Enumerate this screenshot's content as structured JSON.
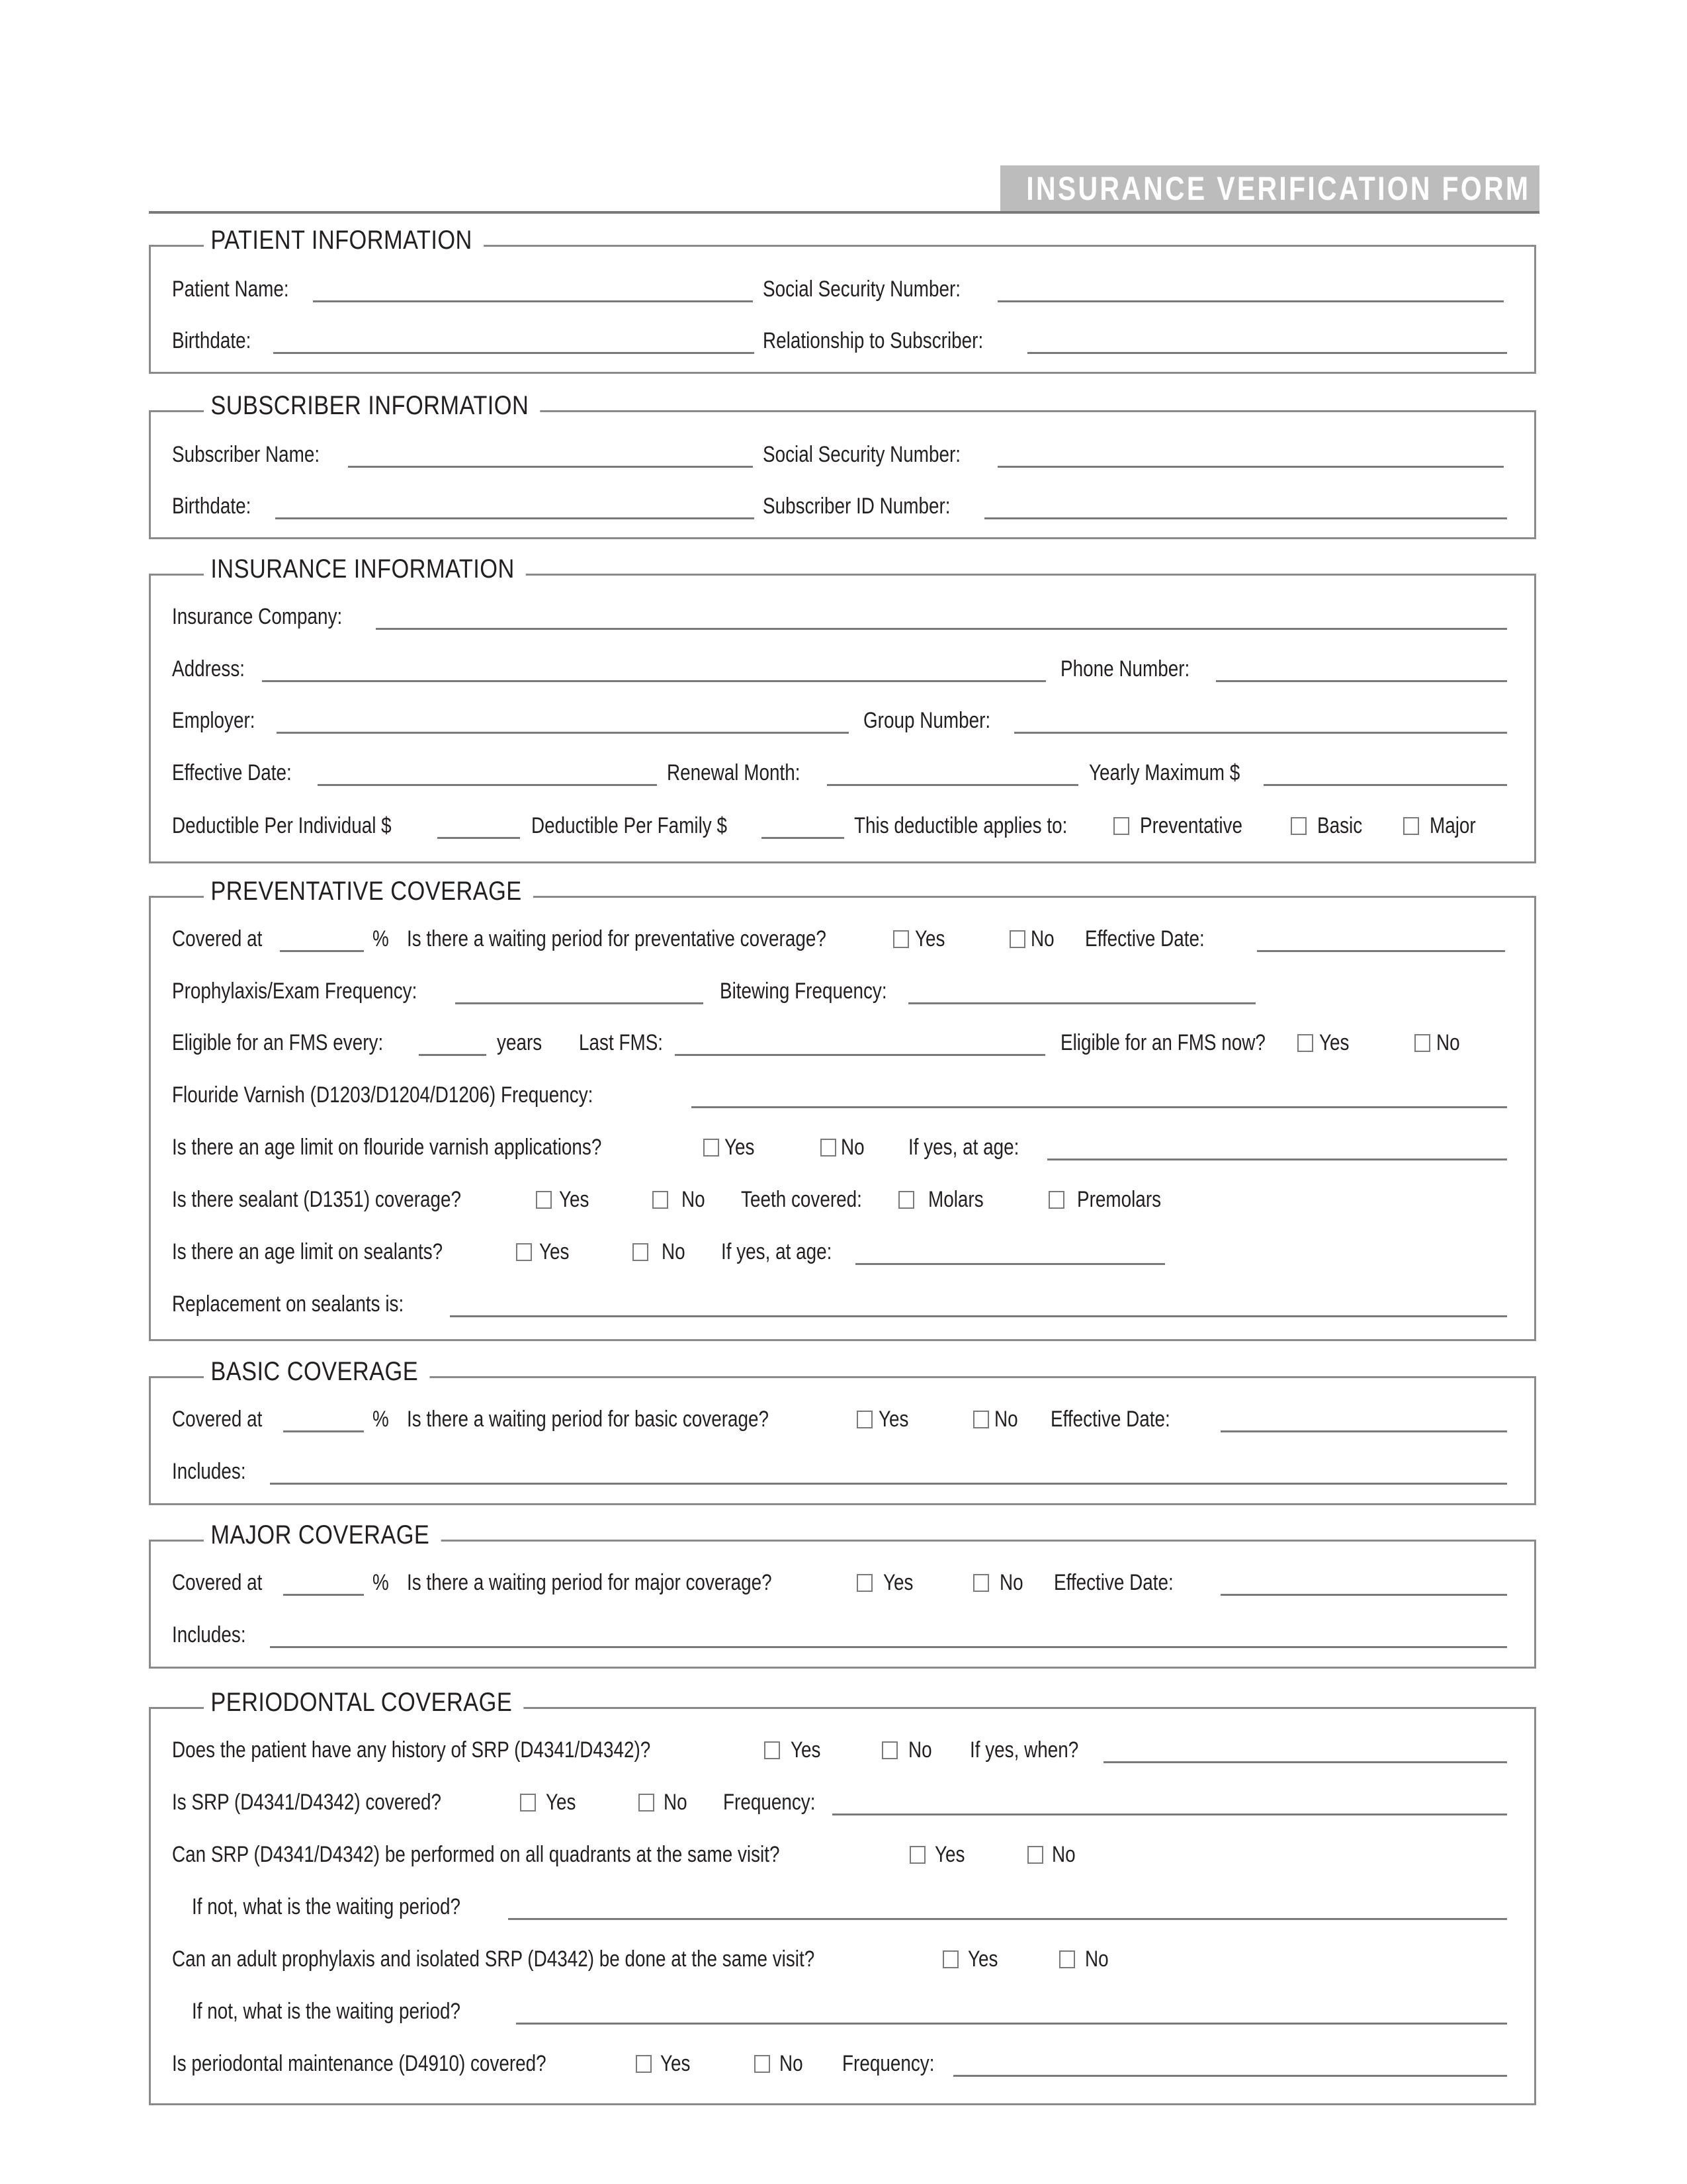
{
  "header": {
    "title": "INSURANCE VERIFICATION FORM"
  },
  "patient": {
    "heading": "PATIENT INFORMATION",
    "name_label": "Patient Name:",
    "ssn_label": "Social Security Number:",
    "birthdate_label": "Birthdate:",
    "relationship_label": "Relationship to Subscriber:"
  },
  "subscriber": {
    "heading": "SUBSCRIBER INFORMATION",
    "name_label": "Subscriber Name:",
    "ssn_label": "Social Security Number:",
    "birthdate_label": "Birthdate:",
    "id_label": "Subscriber ID Number:"
  },
  "insurance": {
    "heading": "INSURANCE INFORMATION",
    "company_label": "Insurance Company:",
    "address_label": "Address:",
    "phone_label": "Phone Number:",
    "employer_label": "Employer:",
    "group_label": "Group Number:",
    "effective_label": "Effective Date:",
    "renewal_label": "Renewal Month:",
    "yearly_max_label": "Yearly Maximum $",
    "ded_individual_label": "Deductible Per Individual $",
    "ded_family_label": "Deductible Per Family $",
    "applies_label": "This deductible applies to:",
    "applies_options": [
      "Preventative",
      "Basic",
      "Major"
    ]
  },
  "preventative": {
    "heading": "PREVENTATIVE COVERAGE",
    "covered_label": "Covered at",
    "percent": "%",
    "waiting_q": "Is there a waiting period for preventative coverage?",
    "yes": "Yes",
    "no": "No",
    "effective_label": "Effective Date:",
    "prophy_label": "Prophylaxis/Exam Frequency:",
    "bitewing_label": "Bitewing Frequency:",
    "fms_every_label": "Eligible for an FMS every:",
    "years": "years",
    "last_fms_label": "Last FMS:",
    "fms_now_q": "Eligible for an FMS now?",
    "fluoride_label": "Flouride Varnish (D1203/D1204/D1206)  Frequency:",
    "fluoride_age_q": "Is there an age limit on flouride varnish applications?",
    "if_yes_age": "If yes, at age:",
    "sealant_q": "Is there sealant (D1351) coverage?",
    "teeth_label": "Teeth covered:",
    "molars": "Molars",
    "premolars": "Premolars",
    "sealant_age_q": "Is there an age limit on sealants?",
    "replacement_label": "Replacement on sealants is:"
  },
  "basic": {
    "heading": "BASIC COVERAGE",
    "covered_label": "Covered at",
    "percent": "%",
    "waiting_q": "Is there a waiting period for basic coverage?",
    "yes": "Yes",
    "no": "No",
    "effective_label": "Effective Date:",
    "includes_label": "Includes:"
  },
  "major": {
    "heading": "MAJOR COVERAGE",
    "covered_label": "Covered at",
    "percent": "%",
    "waiting_q": "Is there a waiting period for major coverage?",
    "yes": "Yes",
    "no": "No",
    "effective_label": "Effective Date:",
    "includes_label": "Includes:"
  },
  "perio": {
    "heading": "PERIODONTAL COVERAGE",
    "yes": "Yes",
    "no": "No",
    "srp_history_q": "Does the patient have any history of SRP (D4341/D4342)?",
    "if_yes_when": "If yes, when?",
    "srp_covered_q": "Is SRP (D4341/D4342) covered?",
    "frequency_label": "Frequency:",
    "srp_quadrants_q": "Can SRP (D4341/D4342) be performed on all quadrants at the same visit?",
    "if_not_waiting": "If not, what is the waiting period?",
    "prophy_srp_q": "Can an adult prophylaxis and isolated SRP (D4342) be done at the same visit?",
    "maintenance_q": "Is periodontal maintenance (D4910) covered?"
  }
}
